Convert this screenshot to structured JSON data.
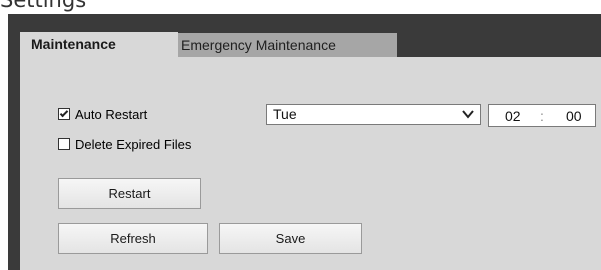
{
  "page_heading": "Settings",
  "tabs": [
    {
      "label": "Maintenance",
      "active": true
    },
    {
      "label": "Emergency Maintenance",
      "active": false
    }
  ],
  "auto_restart": {
    "label": "Auto Restart",
    "checked": true
  },
  "delete_expired": {
    "label": "Delete Expired Files",
    "checked": false
  },
  "day_select": {
    "value": "Tue"
  },
  "time": {
    "hour": "02",
    "separator": ":",
    "minute": "00"
  },
  "buttons": {
    "restart": "Restart",
    "refresh": "Refresh",
    "save": "Save"
  },
  "colors": {
    "panel_dark": "#3a3a3a",
    "content_bg": "#d8d8d8",
    "inactive_tab": "#a6a6a6"
  }
}
